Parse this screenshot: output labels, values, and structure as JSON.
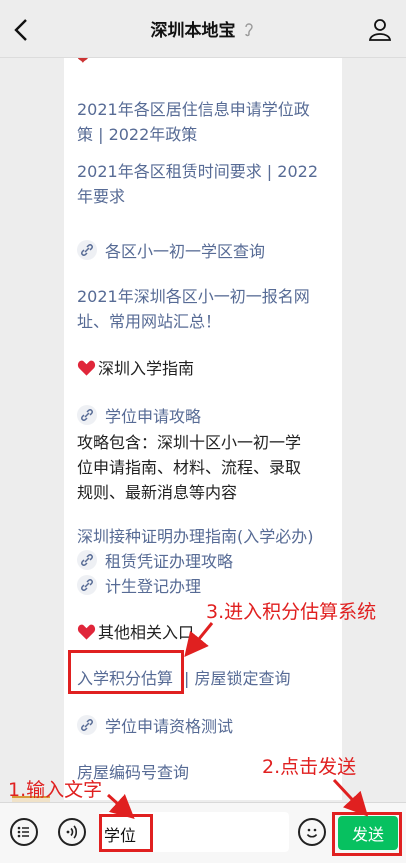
{
  "header": {
    "title": "深圳本地宝"
  },
  "article": {
    "items": [
      {
        "text": "2021年各区居住信息申请学位政",
        "style": "link"
      },
      {
        "text": "策 | 2022年政策",
        "style": "link"
      },
      {
        "text": "2021年各区租赁时间要求 | 2022",
        "style": "link"
      },
      {
        "text": "年要求",
        "style": "link"
      },
      {
        "text": "各区小一初一学区查询",
        "style": "link",
        "icon": "link-icon"
      },
      {
        "text": "2021年深圳各区小一初一报名网",
        "style": "link"
      },
      {
        "text": "址、常用网站汇总！",
        "style": "link"
      },
      {
        "text": "深圳入学指南",
        "style": "dark",
        "icon": "heart-icon"
      },
      {
        "text": "学位申请攻略",
        "style": "link",
        "icon": "link-icon"
      },
      {
        "text": "攻略包含：深圳十区小一初一学",
        "style": "dark"
      },
      {
        "text": "位申请指南、材料、流程、录取",
        "style": "dark"
      },
      {
        "text": "规则、最新消息等内容",
        "style": "dark"
      },
      {
        "text": "深圳接种证明办理指南(入学必办)",
        "style": "link"
      },
      {
        "text": "租赁凭证办理攻略",
        "style": "link",
        "icon": "link-icon"
      },
      {
        "text": "计生登记办理",
        "style": "link",
        "icon": "link-icon"
      },
      {
        "text": "其他相关入口",
        "style": "dark",
        "icon": "heart-icon"
      },
      {
        "text": "入学积分估算",
        "style": "link"
      },
      {
        "text": "| 房屋锁定查询",
        "style": "link"
      },
      {
        "text": "学位申请资格测试",
        "style": "link",
        "icon": "link-icon"
      },
      {
        "text": "房屋编码号查询",
        "style": "link"
      }
    ]
  },
  "input": {
    "value": "学位",
    "send_label": "发送"
  },
  "annotations": {
    "step1": "1.输入文字",
    "step2": "2.点击发送",
    "step3": "3.进入积分估算系统"
  },
  "colors": {
    "link": "#576b95",
    "send": "#07c160",
    "annotation": "#e02020"
  }
}
